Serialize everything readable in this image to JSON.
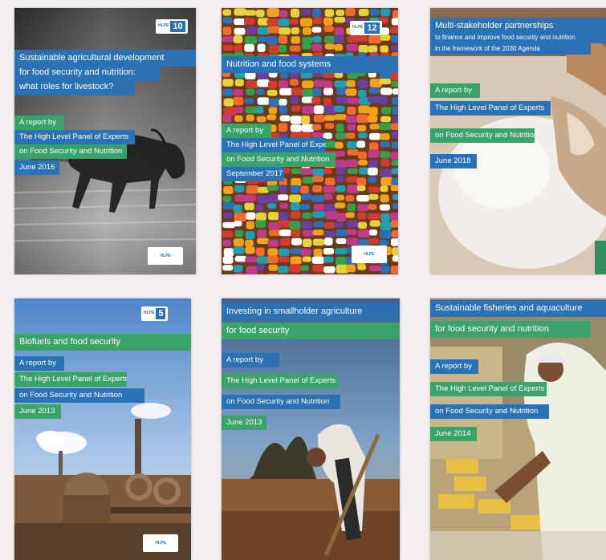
{
  "covers": [
    {
      "title_lines": [
        "Sustainable agricultural development",
        "for food security and nutrition:",
        "what roles for livestock?"
      ],
      "report_lines": [
        "A report by",
        "The High Level Panel of Experts",
        "on Food Security and Nutrition",
        "June 2016"
      ],
      "badge_number": "10",
      "logo_text": "HLPE"
    },
    {
      "title_lines": [
        "Nutrition and food systems"
      ],
      "report_lines": [
        "A report by",
        "The High Level Panel of Experts",
        "on Food Security and Nutrition",
        "September 2017"
      ],
      "badge_number": "12",
      "logo_text": "HLPE"
    },
    {
      "title_lines": [
        "Multi-stakeholder partnerships",
        "to finance and improve food security and nutrition",
        "in the framework of the 2030 Agenda"
      ],
      "report_lines": [
        "A report by",
        "The High Level Panel of Experts",
        "on Food Security and Nutrition",
        "June 2018"
      ]
    },
    {
      "title_lines": [
        "Biofuels and food security"
      ],
      "report_lines": [
        "A report by",
        "The High Level Panel of Experts",
        "on Food Security and Nutrition",
        "June 2013"
      ],
      "badge_number": "5",
      "logo_text": "HLPE"
    },
    {
      "title_lines": [
        "Investing in smallholder agriculture",
        "for food security"
      ],
      "report_lines": [
        "A report by",
        "The High Level Panel of Experts",
        "on Food Security and Nutrition",
        "June 2013"
      ]
    },
    {
      "title_lines": [
        "Sustainable fisheries and aquaculture",
        "for food security and nutrition"
      ],
      "report_lines": [
        "A report by",
        "The High Level Panel of Experts",
        "on Food Security and Nutrition",
        "June 2014"
      ]
    }
  ]
}
